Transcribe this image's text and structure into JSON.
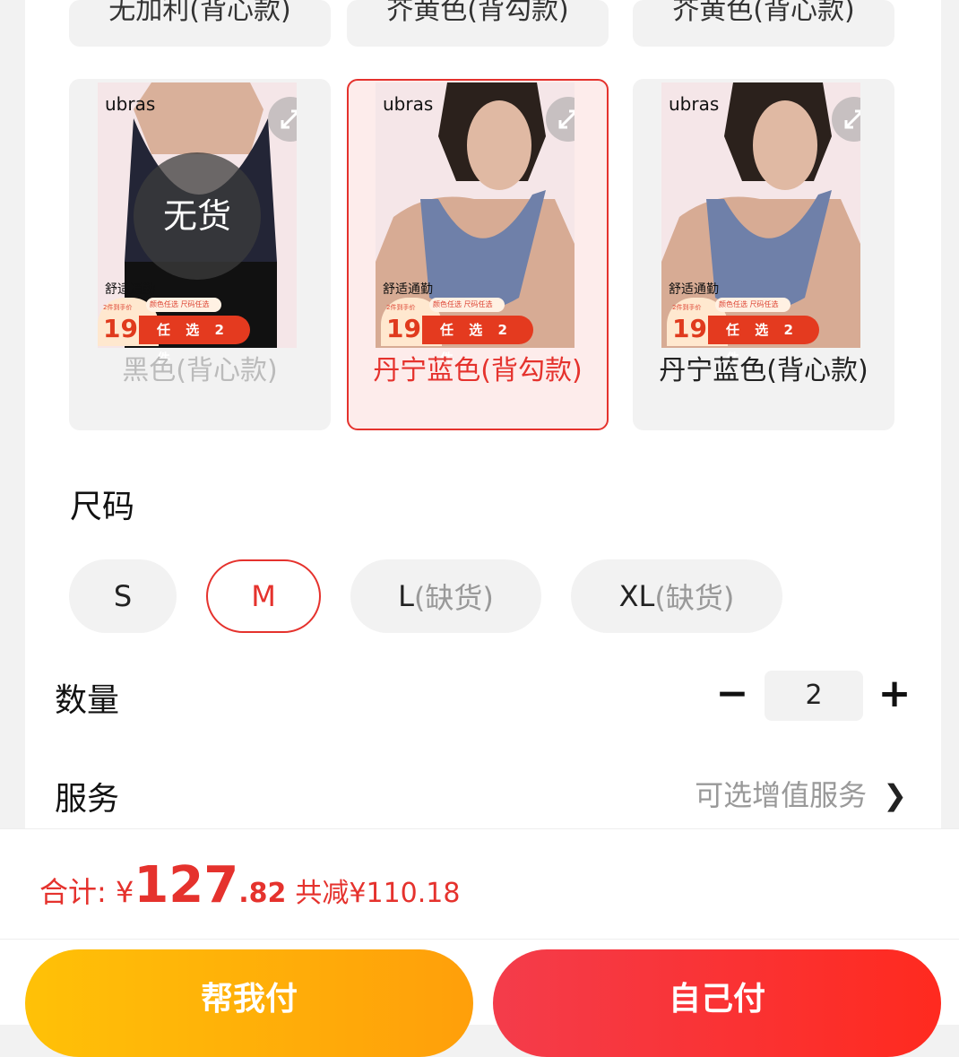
{
  "variants_top": [
    {
      "label": "无加利(背心款)"
    },
    {
      "label": "芥黄色(背勾款)"
    },
    {
      "label": "芥黄色(背心款)"
    }
  ],
  "variants": [
    {
      "name": "黑色(背心款)",
      "brand": "ubras",
      "caption": "舒适通勤",
      "price": "199",
      "deal": "任 选 2 件",
      "badge_small": "2件到手价",
      "top_pill": "颜色任选 尺码任选",
      "out_of_stock": "无货",
      "status": "disabled"
    },
    {
      "name": "丹宁蓝色(背勾款)",
      "brand": "ubras",
      "caption": "舒适通勤",
      "price": "199",
      "deal": "任 选 2 件",
      "badge_small": "2件到手价",
      "top_pill": "颜色任选 尺码任选",
      "status": "selected"
    },
    {
      "name": "丹宁蓝色(背心款)",
      "brand": "ubras",
      "caption": "舒适通勤",
      "price": "199",
      "deal": "任 选 2 件",
      "badge_small": "2件到手价",
      "top_pill": "颜色任选 尺码任选",
      "status": "normal"
    }
  ],
  "size_section": {
    "title": "尺码",
    "options": [
      {
        "label": "S",
        "suffix": ""
      },
      {
        "label": "M",
        "suffix": ""
      },
      {
        "label": "L",
        "suffix": "(缺货)"
      },
      {
        "label": "XL",
        "suffix": "(缺货)"
      }
    ]
  },
  "quantity": {
    "title": "数量",
    "value": "2",
    "minus": "−",
    "plus": "+"
  },
  "service": {
    "title": "服务",
    "value": "可选增值服务",
    "chevron": "❯"
  },
  "footer": {
    "total_label": "合计: ",
    "currency": "¥",
    "total_int": "127",
    "total_dec": ".82",
    "saved": "共减¥110.18",
    "help_pay": "帮我付",
    "self_pay": "自己付"
  },
  "colors": {
    "accent": "#e5322d",
    "help_pay": "#ffb300",
    "self_pay": "#f43c4b"
  }
}
